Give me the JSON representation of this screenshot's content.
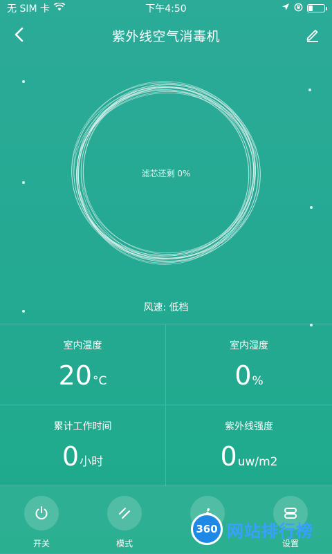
{
  "status_bar": {
    "carrier": "无 SIM 卡",
    "time": "下午4:50"
  },
  "header": {
    "title": "紫外线空气消毒机"
  },
  "filter": {
    "label": "滤芯还剩 0%"
  },
  "wind": {
    "label": "风速: 低档"
  },
  "stats": [
    {
      "label": "室内温度",
      "value": "20",
      "unit": "°C"
    },
    {
      "label": "室内湿度",
      "value": "0",
      "unit": "%"
    },
    {
      "label": "累计工作时间",
      "value": "0",
      "unit": "小时"
    },
    {
      "label": "紫外线强度",
      "value": "0",
      "unit": "uw/m2"
    }
  ],
  "tabs": [
    {
      "label": "开关",
      "icon": "power-icon"
    },
    {
      "label": "模式",
      "icon": "mode-icon"
    },
    {
      "label": "",
      "icon": "fan-icon"
    },
    {
      "label": "设置",
      "icon": "settings-icon"
    }
  ],
  "watermark": {
    "badge": "360",
    "text": "网站排行榜"
  },
  "colors": {
    "background_top": "#2bab98",
    "background_bottom": "#1eaa8b",
    "accent": "#ffffff"
  }
}
